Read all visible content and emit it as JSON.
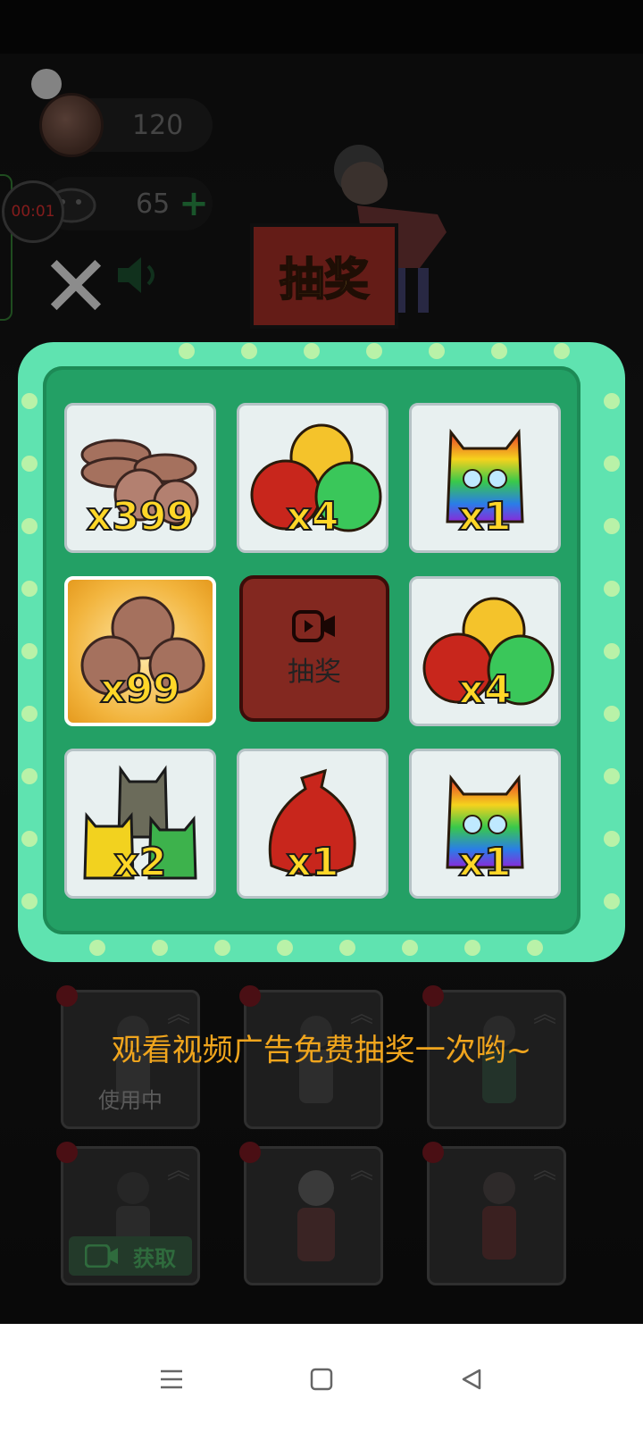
{
  "resources": {
    "coins": "120",
    "energy": "65",
    "plus": "+"
  },
  "recorder": {
    "timer": "00:01"
  },
  "close_label": "✕",
  "banner_title": "抽奖",
  "grid": [
    {
      "qty": "x399",
      "item": "coin-stack"
    },
    {
      "qty": "x4",
      "item": "bag-trio"
    },
    {
      "qty": "x1",
      "item": "rainbow-cat"
    },
    {
      "qty": "x99",
      "item": "coin-trio",
      "selected": true
    },
    {
      "qty": "",
      "item": "center"
    },
    {
      "qty": "x4",
      "item": "bag-trio"
    },
    {
      "qty": "x2",
      "item": "cat-trio"
    },
    {
      "qty": "x1",
      "item": "red-bag"
    },
    {
      "qty": "x1",
      "item": "rainbow-cat"
    }
  ],
  "center_button": {
    "label": "抽奖",
    "icon": "video-icon"
  },
  "hint_text": "观看视频广告免费抽奖一次哟~",
  "cards": [
    {
      "status": "使用中"
    },
    {
      "status": ""
    },
    {
      "status": ""
    },
    {
      "status": "获取"
    },
    {
      "status": ""
    },
    {
      "status": ""
    }
  ],
  "nav": {
    "menu": "menu-icon",
    "home": "home-icon",
    "back": "back-icon"
  },
  "colors": {
    "panel": "#5fe3b0",
    "panel_inner": "#23a065",
    "qty": "#ffd728",
    "hint": "#f0a51d",
    "center_btn": "#832820"
  }
}
